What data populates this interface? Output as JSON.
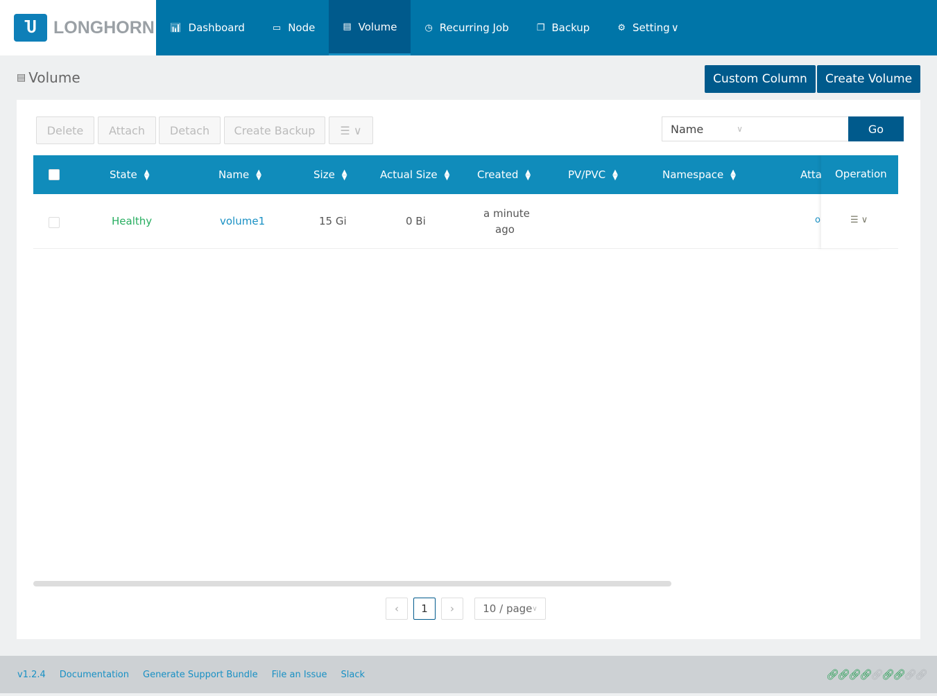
{
  "brand": "LONGHORN",
  "nav": [
    {
      "label": "Dashboard",
      "icon": "chart-icon"
    },
    {
      "label": "Node",
      "icon": "laptop-icon"
    },
    {
      "label": "Volume",
      "icon": "volume-icon"
    },
    {
      "label": "Recurring Job",
      "icon": "clock-icon"
    },
    {
      "label": "Backup",
      "icon": "copy-icon"
    },
    {
      "label": "Setting",
      "icon": "gear-icon"
    }
  ],
  "page_title": "Volume",
  "actions": {
    "custom_column": "Custom Column",
    "create_volume": "Create Volume"
  },
  "toolbar": {
    "delete": "Delete",
    "attach": "Attach",
    "detach": "Detach",
    "create_backup": "Create Backup"
  },
  "search": {
    "field": "Name",
    "value": "",
    "go": "Go"
  },
  "columns": [
    "State",
    "Name",
    "Size",
    "Actual Size",
    "Created",
    "PV/PVC",
    "Namespace",
    "Atta",
    "Operation"
  ],
  "rows": [
    {
      "state": "Healthy",
      "name": "volume1",
      "size": "15 Gi",
      "actual_size": "0 Bi",
      "created_1": "a minute",
      "created_2": "ago",
      "attached": "o"
    }
  ],
  "pagination": {
    "page": "1",
    "page_size": "10 / page"
  },
  "footer": {
    "version": "v1.2.4",
    "links": [
      "Documentation",
      "Generate Support Bundle",
      "File an Issue",
      "Slack"
    ]
  },
  "status_links": {
    "colors": {
      "ok": "#1a9a4a",
      "off": "#b0b4b8"
    },
    "states": [
      true,
      true,
      true,
      true,
      false,
      true,
      true,
      false,
      false
    ]
  }
}
